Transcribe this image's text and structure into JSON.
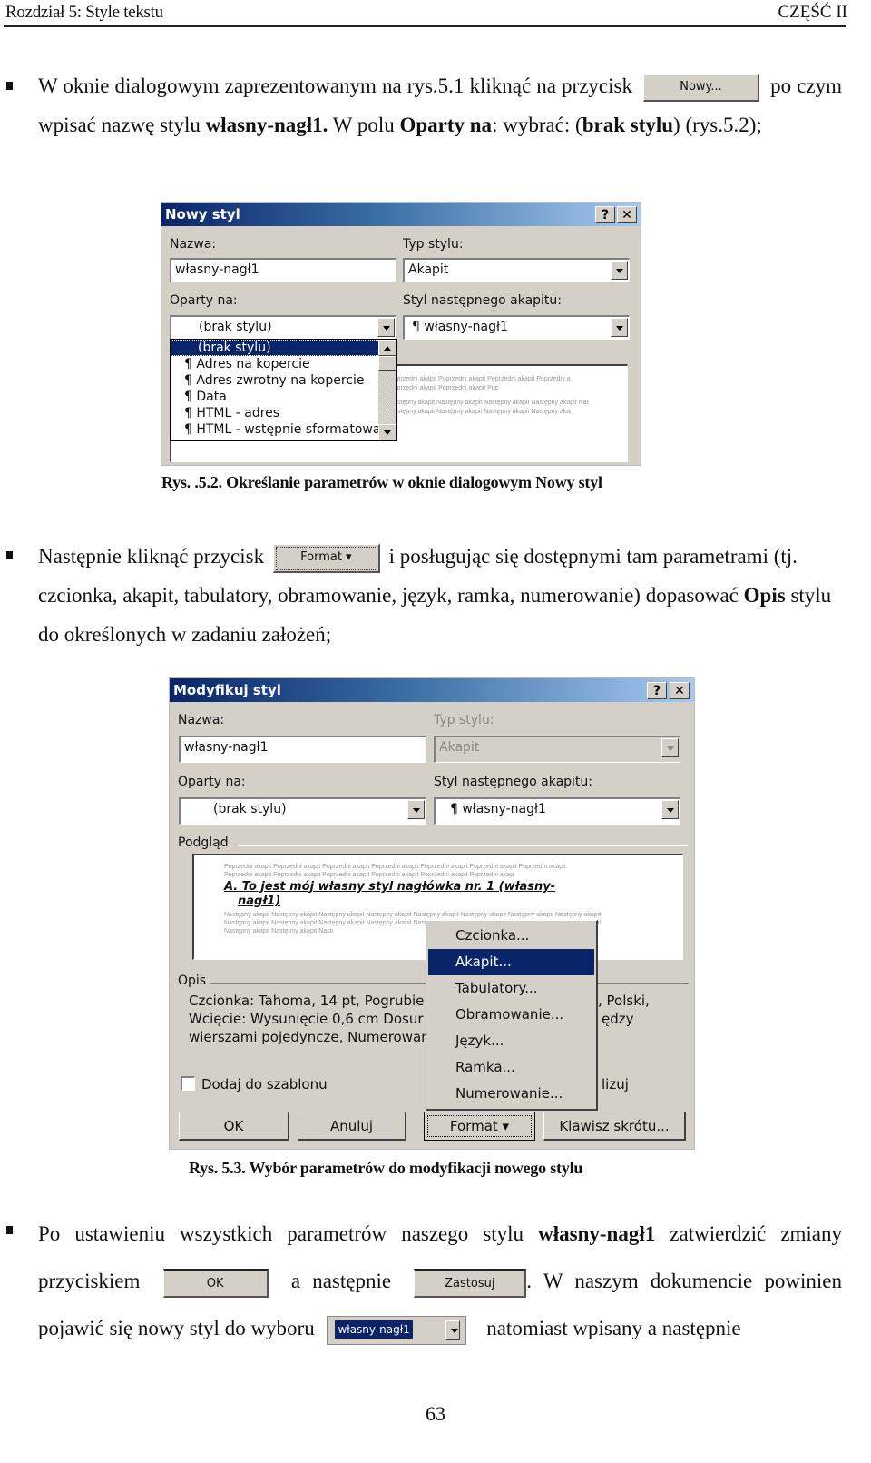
{
  "header": {
    "chapter": "Rozdział 5: Style tekstu",
    "part": "CZĘŚĆ II"
  },
  "paragraph1": {
    "t1": "W oknie dialogowym zaprezentowanym na rys.5.1 kliknąć na przycisk",
    "button": "Nowy...",
    "t2": "po czym wpisać nazwę stylu",
    "b1": "własny-nagł1.",
    "t3": "W polu",
    "b2": "Oparty na",
    "t4": ": wybrać: (",
    "b3": "brak stylu",
    "t5": ") (rys.5.2);"
  },
  "dialog1": {
    "title": "Nowy styl",
    "help": "?",
    "close": "✕",
    "name_label": "Nazwa:",
    "name_value": "własny-nagł1",
    "type_label": "Typ stylu:",
    "type_value": "Akapit",
    "based_label": "Oparty na:",
    "based_value": "(brak stylu)",
    "next_label": "Styl następnego akapitu:",
    "next_value": "¶ własny-nagł1",
    "list_items": [
      "(brak stylu)",
      "¶ Adres na kopercie",
      "¶ Adres zwrotny na kopercie",
      "¶ Data",
      "¶ HTML - adres",
      "¶ HTML - wstępnie sformatowa"
    ],
    "selected_index": 0,
    "preview_prev": "Poprzedni akapit Poprzedni akapit Poprzedni akapit Poprzedni akapit Poprzedni akapit Poprzedni akapit",
    "preview_next": "Następny akapit Następny akapit Następny akapit Następny akapit Następny akapit Następny akapit Następny akapit"
  },
  "caption1": "Rys. .5.2. Określanie parametrów w oknie dialogowym Nowy styl",
  "paragraph2": {
    "t1": "Następnie kliknąć przycisk",
    "button": "Format ▾",
    "t2": "i posługując się dostępnymi tam parametrami (tj. czcionka, akapit, tabulatory, obramowanie, język, ramka, numerowanie) dopasować",
    "b1": "Opis",
    "t3": "stylu do określonych w zadaniu założeń;"
  },
  "dialog2": {
    "title": "Modyfikuj styl",
    "help": "?",
    "close": "✕",
    "name_label": "Nazwa:",
    "name_value": "własny-nagł1",
    "type_label": "Typ stylu:",
    "type_value": "Akapit",
    "based_label": "Oparty na:",
    "based_value": "(brak stylu)",
    "next_label": "Styl następnego akapitu:",
    "next_value": "¶ własny-nagł1",
    "preview_label": "Podgląd",
    "preview_prev": "Poprzedni akapit Poprzedni akapit Poprzedni akapit Poprzedni akapit Poprzedni akapit Poprzedni akapit Poprzedni akapit",
    "preview_heading_1": "A.   To jest mój własny styl nagłówka nr. 1 (własny-",
    "preview_heading_2": "nagł1)",
    "preview_next": "Następny akapit Następny akapit Następny akapit Następny akapit Następny akapit Następny akapit Następny akapit Następny akapit",
    "desc_label": "Opis",
    "desc_line1": "Czcionka: Tahoma, 14 pt, Pogrubie",
    "desc_line1_tail": ", Polski,",
    "desc_line2": "Wcięcie:  Wysunięcie  0,6 cm Dosur",
    "desc_line2_tail": "ędzy",
    "desc_line3": "wierszami pojedyncze, Numerowan",
    "add_template_label": "Dodaj do szablonu",
    "add_template_checked": false,
    "auto_update_tail": "lizuj",
    "btn_ok": "OK",
    "btn_cancel": "Anuluj",
    "btn_format": "Format ▾",
    "btn_shortcut": "Klawisz skrótu...",
    "menu_items": [
      "Czcionka...",
      "Akapit...",
      "Tabulatory...",
      "Obramowanie...",
      "Język...",
      "Ramka...",
      "Numerowanie..."
    ],
    "menu_highlighted_index": 1
  },
  "caption2": "Rys. 5.3. Wybór parametrów do modyfikacji nowego stylu",
  "paragraph3": {
    "t1": "Po ustawieniu wszystkich parametrów naszego stylu",
    "b1": "własny-nagł1",
    "t2": "zatwierdzić zmiany",
    "t3": "przyciskiem",
    "btn_ok": "OK",
    "t4": "a następnie",
    "btn_apply": "Zastosuj",
    "t5": ". W naszym dokumencie powinien",
    "t6": "pojawić  się  nowy  styl  do  wyboru",
    "style_box_value": "własny-nagł1",
    "t7": "natomiast  wpisany  a następnie"
  },
  "page_number": "63"
}
